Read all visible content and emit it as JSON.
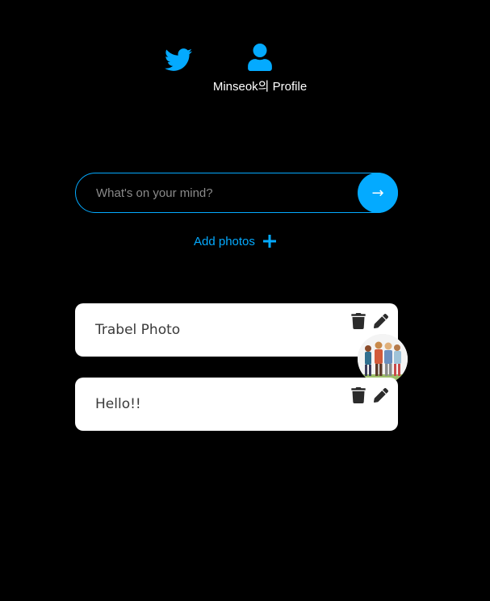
{
  "nav": {
    "home_icon": "twitter-bird-icon",
    "profile_icon": "user-icon",
    "profile_label": "Minseok의 Profile"
  },
  "form": {
    "placeholder": "What's on your mind?",
    "value": "",
    "submit_label": "→",
    "add_photos_label": "Add photos",
    "add_photos_icon": "plus-icon"
  },
  "tweets": [
    {
      "text": "Trabel Photo",
      "has_photo": true,
      "actions": [
        "trash-icon",
        "pencil-icon"
      ]
    },
    {
      "text": "Hello!!",
      "has_photo": false,
      "actions": [
        "trash-icon",
        "pencil-icon"
      ]
    }
  ],
  "colors": {
    "accent": "#04aaff",
    "background": "#000000",
    "card": "#ffffff",
    "card_text": "#3a3a3a",
    "icon_dark": "#2b2b2b"
  }
}
